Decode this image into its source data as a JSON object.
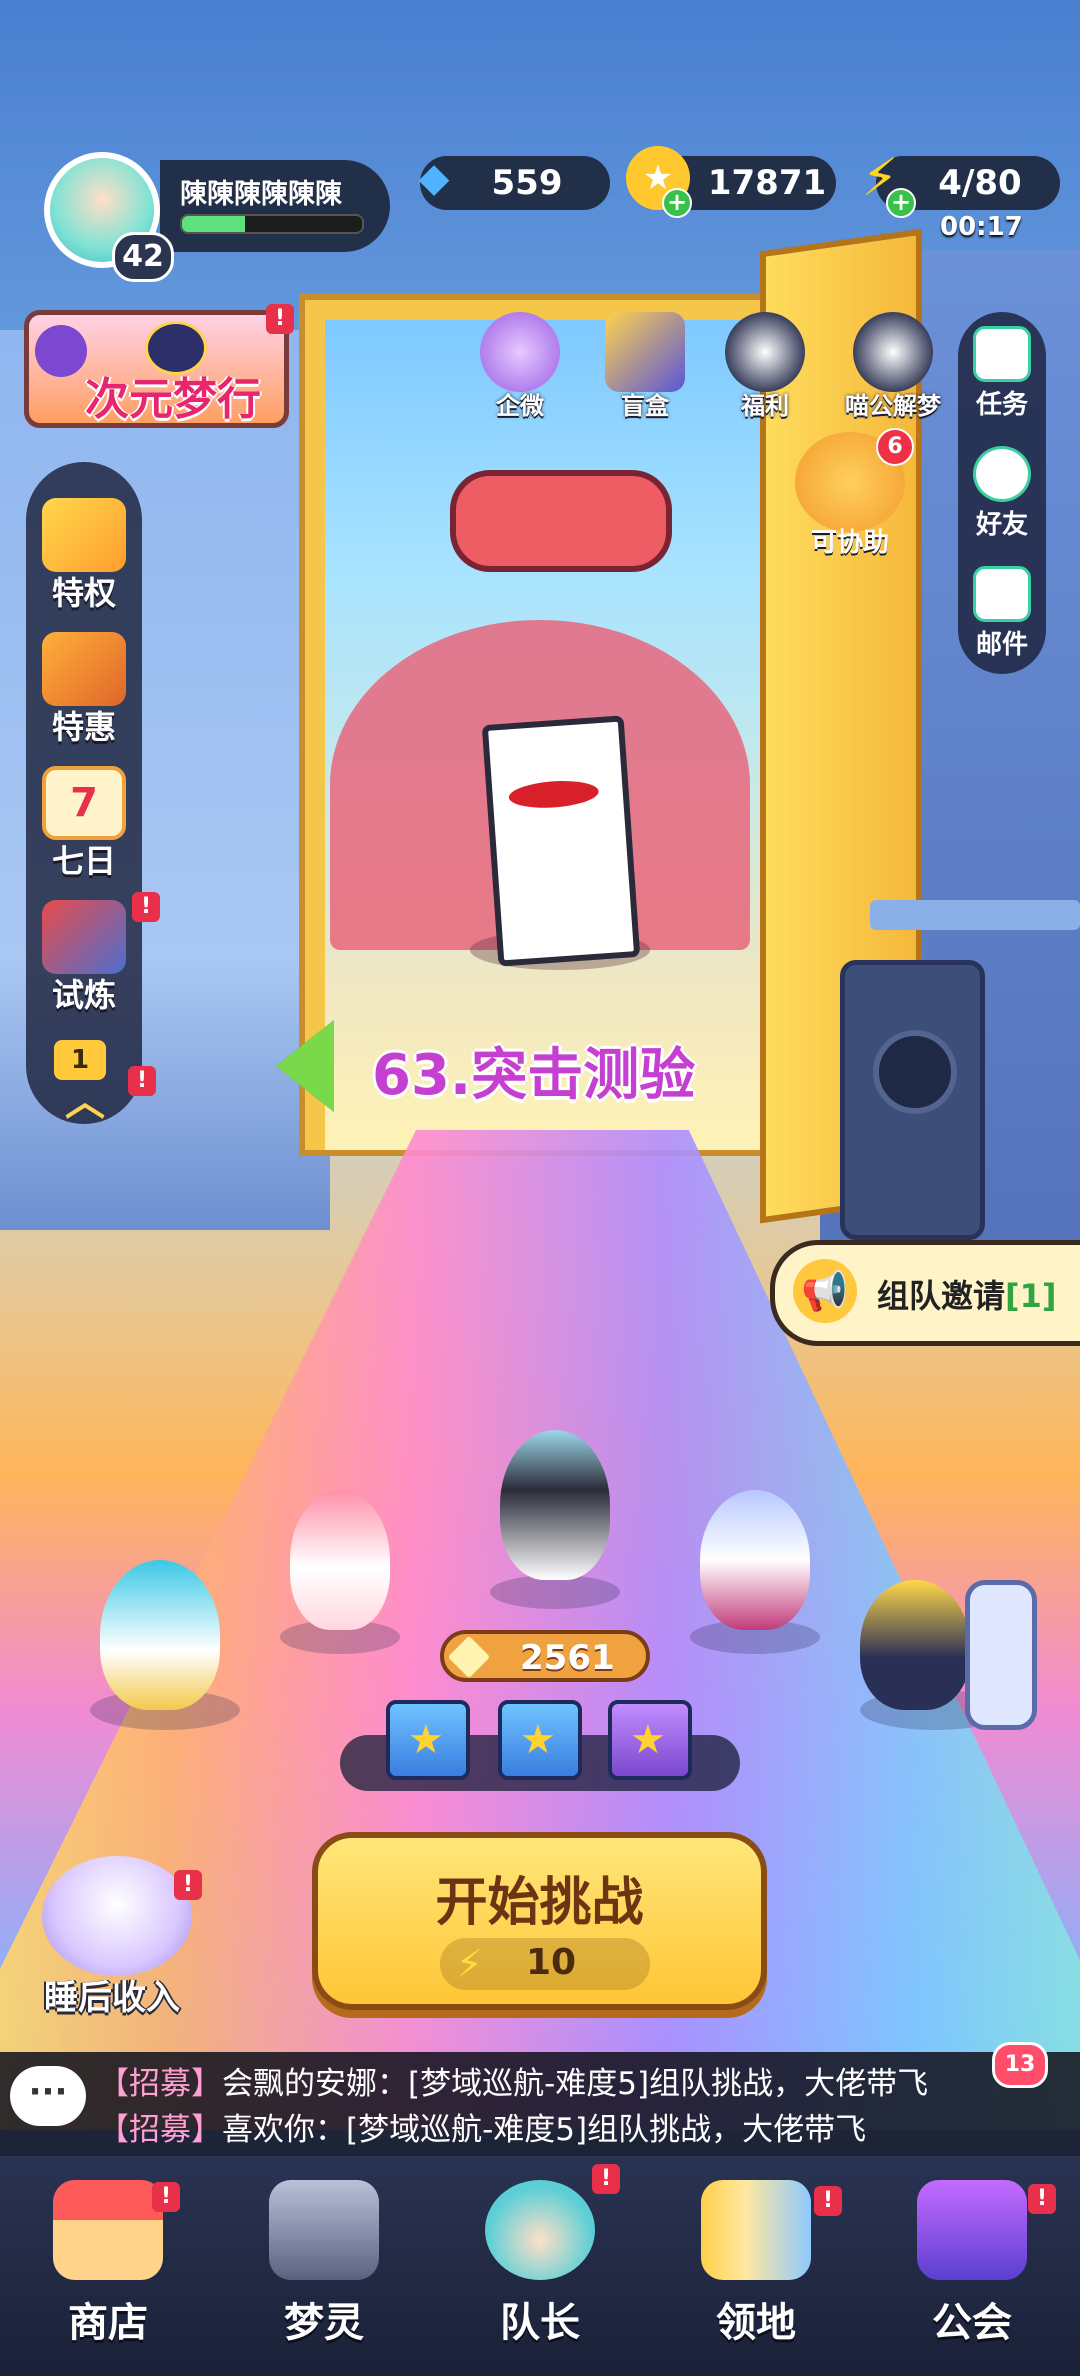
{
  "player": {
    "name": "陳陳陳陳陳陳",
    "level": "42",
    "exp_fraction": 0.35
  },
  "resources": {
    "gems": "559",
    "coins": "17871",
    "energy": "4/80",
    "energy_timer": "00:17"
  },
  "event_banner": {
    "title": "次元梦行",
    "alert": "!"
  },
  "left_menu": [
    {
      "label": "特权",
      "icon": "privilege-tickets-icon",
      "alert": ""
    },
    {
      "label": "特惠",
      "icon": "sale-box-icon",
      "alert": ""
    },
    {
      "label": "七日",
      "icon": "seven-day-calendar-icon",
      "calendar_number": "7",
      "alert": ""
    },
    {
      "label": "试炼",
      "icon": "trial-cannon-icon",
      "alert": "!"
    }
  ],
  "left_menu_extra": {
    "alert": "!",
    "badge_number": "1"
  },
  "top_features": [
    {
      "label": "企微",
      "icon": "gift-icon"
    },
    {
      "label": "盲盒",
      "icon": "blind-box-icon"
    },
    {
      "label": "福利",
      "icon": "welfare-robot-icon"
    },
    {
      "label": "喵公解梦",
      "icon": "cat-dream-icon"
    }
  ],
  "assist": {
    "label": "可协助",
    "count": "6"
  },
  "right_menu": [
    {
      "label": "任务",
      "icon": "task-notebook-icon"
    },
    {
      "label": "好友",
      "icon": "friends-icon"
    },
    {
      "label": "邮件",
      "icon": "mail-icon"
    }
  ],
  "stage": {
    "title": "63.突击测验"
  },
  "team_invite": {
    "label": "组队邀请",
    "count_text": "[1]"
  },
  "team": {
    "power": "2561",
    "chests": 3
  },
  "start": {
    "label": "开始挑战",
    "cost": "10"
  },
  "offline_income": {
    "label": "睡后收入",
    "alert": "!"
  },
  "chat": {
    "unread": "13",
    "messages": [
      {
        "tag": "【招募】",
        "text": "会飘的安娜：[梦域巡航-难度5]组队挑战，大佬带飞"
      },
      {
        "tag": "【招募】",
        "text": "喜欢你：[梦域巡航-难度5]组队挑战，大佬带飞"
      }
    ]
  },
  "nav": [
    {
      "label": "商店",
      "icon": "shop-stall-icon",
      "alert": "!"
    },
    {
      "label": "梦灵",
      "icon": "dream-spirit-machine-icon",
      "alert": ""
    },
    {
      "label": "队长",
      "icon": "captain-portrait-icon",
      "alert": "!"
    },
    {
      "label": "领地",
      "icon": "territory-door-icon",
      "alert": "!"
    },
    {
      "label": "公会",
      "icon": "guild-hat-icon",
      "alert": "!"
    }
  ],
  "colors": {
    "accent_yellow": "#ffc636",
    "alert_red": "#e8304a",
    "stage_purple": "#c53fd1",
    "exp_green": "#5ee07d"
  }
}
